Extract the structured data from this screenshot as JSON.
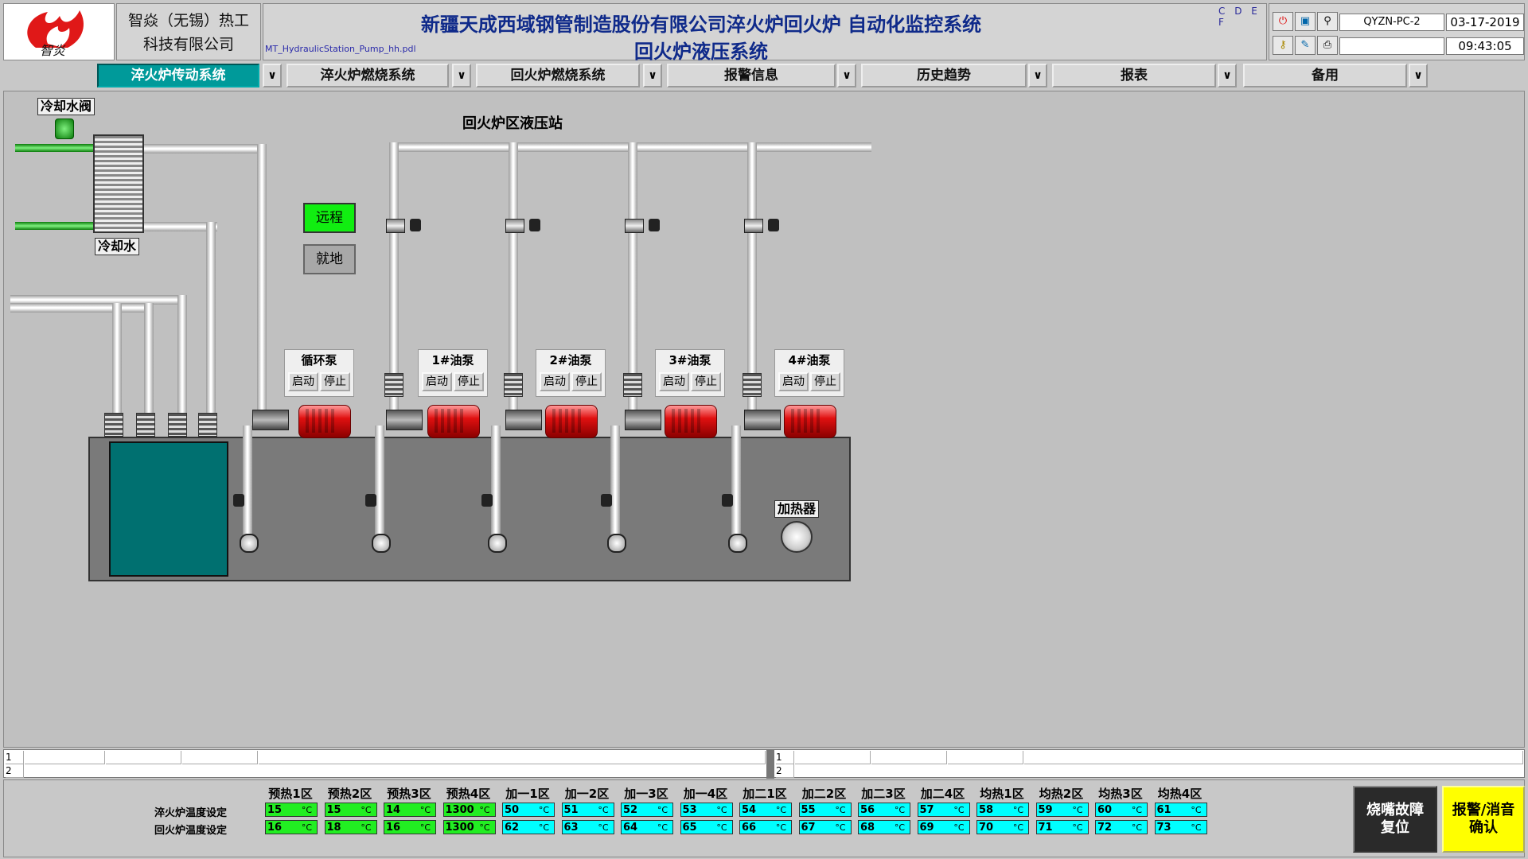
{
  "header": {
    "company_line1": "智焱（无锡）热工",
    "company_line2": "科技有限公司",
    "title_line1": "新疆天成西域钢管制造股份有限公司淬火炉回火炉 自动化监控系统",
    "title_line2": "回火炉液压系统",
    "filename": "MT_HydraulicStation_Pump_hh.pdl",
    "drives": "C D E F",
    "pc_name": "QYZN-PC-2",
    "date": "03-17-2019",
    "time": "09:43:05"
  },
  "nav": [
    {
      "label": "淬火炉传动系统",
      "dropdown": "∨"
    },
    {
      "label": "淬火炉燃烧系统",
      "dropdown": "∨"
    },
    {
      "label": "回火炉燃烧系统",
      "dropdown": "∨"
    },
    {
      "label": "报警信息",
      "dropdown": "∨"
    },
    {
      "label": "历史趋势",
      "dropdown": "∨"
    },
    {
      "label": "报表",
      "dropdown": "∨"
    },
    {
      "label": "备用",
      "dropdown": "∨"
    }
  ],
  "diagram": {
    "station_title": "回火炉区液压站",
    "cooling_valve": "冷却水阀",
    "cooling_water": "冷却水",
    "heater": "加热器",
    "mode_remote": "远程",
    "mode_local": "就地",
    "pumps": [
      {
        "name": "循环泵",
        "start": "启动",
        "stop": "停止"
      },
      {
        "name": "1#油泵",
        "start": "启动",
        "stop": "停止"
      },
      {
        "name": "2#油泵",
        "start": "启动",
        "stop": "停止"
      },
      {
        "name": "3#油泵",
        "start": "启动",
        "stop": "停止"
      },
      {
        "name": "4#油泵",
        "start": "启动",
        "stop": "停止"
      }
    ]
  },
  "statusbar": {
    "row1": "1",
    "row2": "2"
  },
  "temps": {
    "row_labels": [
      "淬火炉温度设定",
      "回火炉温度设定"
    ],
    "unit": "°C",
    "zones": [
      "预热1区",
      "预热2区",
      "预热3区",
      "预热4区",
      "加一1区",
      "加一2区",
      "加一3区",
      "加一4区",
      "加二1区",
      "加二2区",
      "加二3区",
      "加二4区",
      "均热1区",
      "均热2区",
      "均热3区",
      "均热4区"
    ],
    "row1": [
      "15",
      "15",
      "14",
      "1300",
      "50",
      "51",
      "52",
      "53",
      "54",
      "55",
      "56",
      "57",
      "58",
      "59",
      "60",
      "61"
    ],
    "row2": [
      "16",
      "18",
      "16",
      "1300",
      "62",
      "63",
      "64",
      "65",
      "66",
      "67",
      "68",
      "69",
      "70",
      "71",
      "72",
      "73"
    ],
    "colors": {
      "green": "#22ee22",
      "cyan": "#00ffff"
    }
  },
  "buttons": {
    "fault_reset": "烧嘴故障复位",
    "alarm_ack": "报警/消音确认"
  }
}
